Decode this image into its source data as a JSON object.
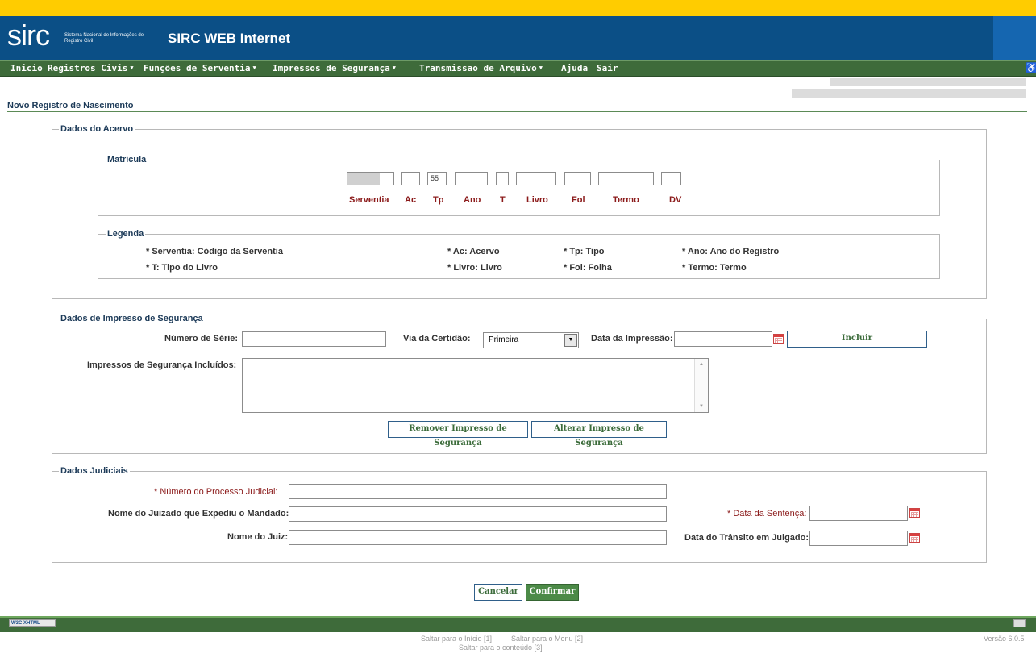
{
  "header": {
    "logo": "sirc",
    "logo_subtitle": "Sistema Nacional de Informações de Registro Civil",
    "title": "SIRC WEB Internet"
  },
  "menu": {
    "items": [
      {
        "label": "Inicio",
        "dropdown": false
      },
      {
        "label": "Registros Civis",
        "dropdown": true
      },
      {
        "label": "Funções de Serventia",
        "dropdown": true
      },
      {
        "label": "Impressos de Segurança",
        "dropdown": true
      },
      {
        "label": "Transmissão de Arquivo",
        "dropdown": true
      },
      {
        "label": "Ajuda",
        "dropdown": false
      },
      {
        "label": "Sair",
        "dropdown": false
      }
    ],
    "accessibility_icon": "wheelchair-icon"
  },
  "page": {
    "title": "Novo Registro de Nascimento"
  },
  "acervo": {
    "legend": "Dados do Acervo",
    "matricula": {
      "legend": "Matrícula",
      "fields": [
        {
          "label": "Serventia",
          "value": ""
        },
        {
          "label": "Ac",
          "value": ""
        },
        {
          "label": "Tp",
          "value": "55"
        },
        {
          "label": "Ano",
          "value": ""
        },
        {
          "label": "T",
          "value": ""
        },
        {
          "label": "Livro",
          "value": ""
        },
        {
          "label": "Fol",
          "value": ""
        },
        {
          "label": "Termo",
          "value": ""
        },
        {
          "label": "DV",
          "value": ""
        }
      ]
    },
    "legenda": {
      "legend": "Legenda",
      "items": [
        "* Serventia: Código da Serventia",
        "* Ac: Acervo",
        "* Tp: Tipo",
        "* Ano: Ano do Registro",
        "* T: Tipo do Livro",
        "* Livro: Livro",
        "* Fol: Folha",
        "* Termo: Termo"
      ]
    }
  },
  "impresso": {
    "legend": "Dados de Impresso de Segurança",
    "numero_serie_label": "Número de Série:",
    "numero_serie_value": "",
    "via_label": "Via da Certidão:",
    "via_value": "Primeira",
    "data_impressao_label": "Data da Impressão:",
    "data_impressao_value": "",
    "incluir_button": "Incluir",
    "incluidos_label": "Impressos de Segurança Incluídos:",
    "remover_button": "Remover Impresso de Segurança",
    "alterar_button": "Alterar Impresso de Segurança"
  },
  "judiciais": {
    "legend": "Dados Judiciais",
    "processo_label": "* Número do Processo Judicial:",
    "juizado_label": "Nome do Juizado que Expediu o Mandado:",
    "juiz_label": "Nome do Juiz:",
    "data_sentenca_label": "* Data da Sentença:",
    "data_transito_label": "Data do Trânsito em Julgado:"
  },
  "actions": {
    "cancel": "Cancelar",
    "confirm": "Confirmar"
  },
  "footer": {
    "badge": "W3C XHTML",
    "links": [
      "Saltar para o Início [1]",
      "Saltar para o Menu [2]",
      "Saltar para o conteúdo [3]"
    ],
    "version": "Versão 6.0.5"
  },
  "colors": {
    "top_band": "#ffcc00",
    "header": "#0b4f86",
    "menubar": "#3e6b3a",
    "label_red": "#8b1a1a"
  }
}
